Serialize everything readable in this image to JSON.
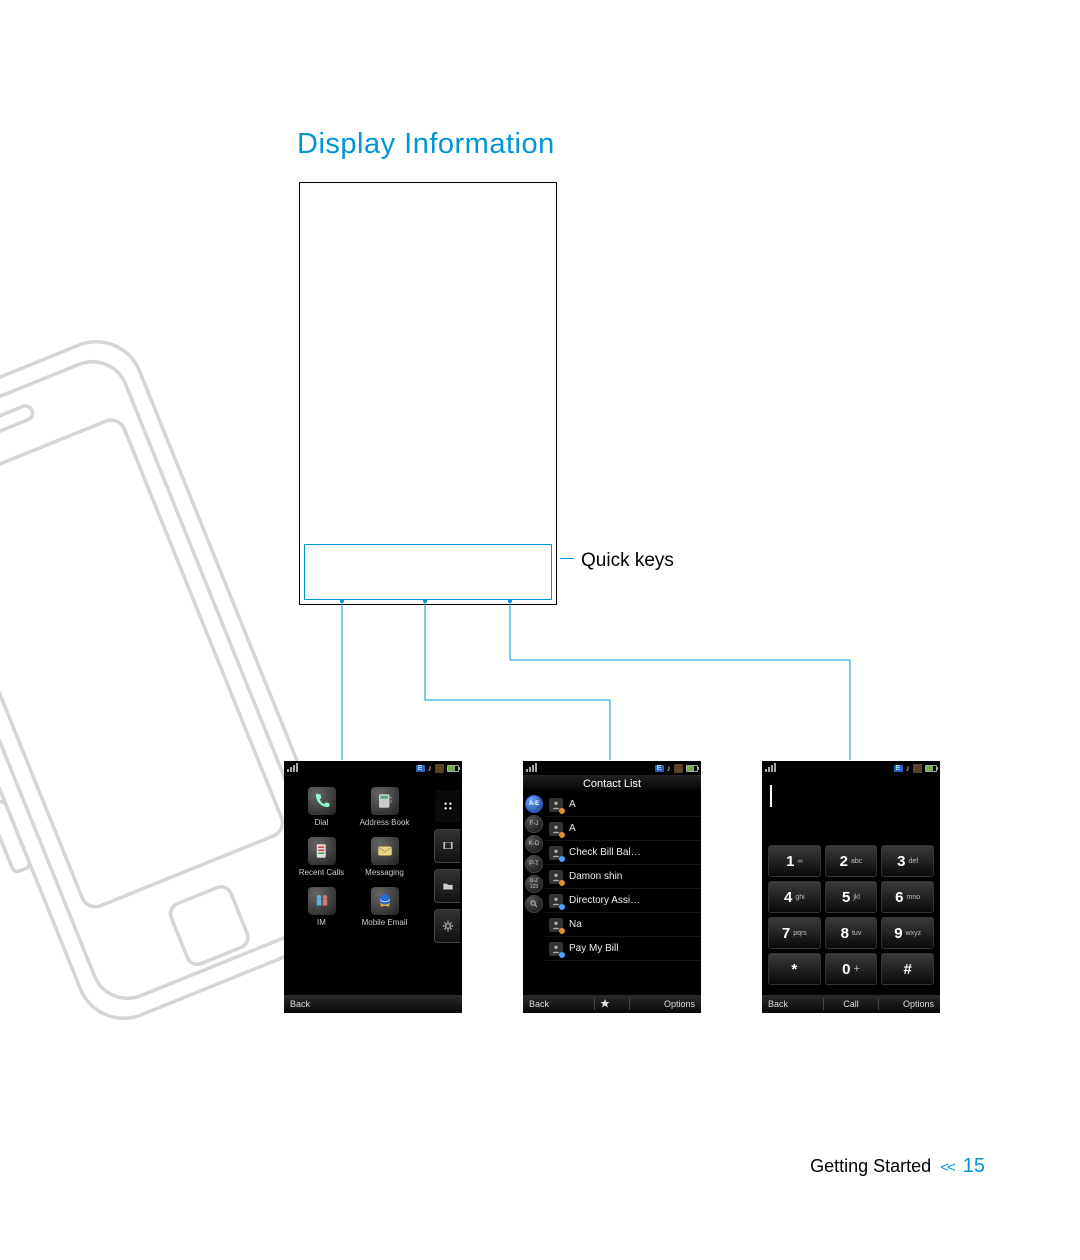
{
  "title": "Display Information",
  "callout_quick_keys": "Quick keys",
  "footer": {
    "section": "Getting Started",
    "chevrons": "<<",
    "page": "15"
  },
  "status_icons": {
    "network_badge": "E",
    "music": "♪"
  },
  "shot1": {
    "apps": [
      {
        "id": "dial",
        "label": "Dial"
      },
      {
        "id": "address-book",
        "label": "Address Book"
      },
      {
        "id": "recent-calls",
        "label": "Recent Calls"
      },
      {
        "id": "messaging",
        "label": "Messaging"
      },
      {
        "id": "im",
        "label": "IM"
      },
      {
        "id": "mobile-email",
        "label": "Mobile Email"
      }
    ],
    "side_tabs": [
      "apps",
      "media",
      "folder",
      "settings"
    ],
    "softkeys": {
      "left": "Back"
    }
  },
  "shot2": {
    "title": "Contact List",
    "alpha_tabs": [
      "A-E",
      "F-J",
      "K-O",
      "P-T",
      "U-Z 123",
      "🔍"
    ],
    "alpha_active": 0,
    "contacts": [
      {
        "name": "A",
        "dot": "#e08a2a"
      },
      {
        "name": "A",
        "dot": "#e08a2a"
      },
      {
        "name": "Check Bill Bal…",
        "dot": "#4aa3ff"
      },
      {
        "name": "Damon shin",
        "dot": "#e08a2a"
      },
      {
        "name": "Directory Assi…",
        "dot": "#4aa3ff"
      },
      {
        "name": "Na",
        "dot": "#e08a2a"
      },
      {
        "name": "Pay My Bill",
        "dot": "#4aa3ff"
      }
    ],
    "softkeys": {
      "left": "Back",
      "right": "Options"
    }
  },
  "shot3": {
    "keys": [
      {
        "digit": "1",
        "sub": "∞"
      },
      {
        "digit": "2",
        "sub": "abc"
      },
      {
        "digit": "3",
        "sub": "def"
      },
      {
        "digit": "4",
        "sub": "ghi"
      },
      {
        "digit": "5",
        "sub": "jkl"
      },
      {
        "digit": "6",
        "sub": "mno"
      },
      {
        "digit": "7",
        "sub": "pqrs"
      },
      {
        "digit": "8",
        "sub": "tuv"
      },
      {
        "digit": "9",
        "sub": "wxyz"
      },
      {
        "digit": "*",
        "sub": ""
      },
      {
        "digit": "0",
        "sub": "+"
      },
      {
        "digit": "#",
        "sub": ""
      }
    ],
    "softkeys": {
      "left": "Back",
      "center": "Call",
      "right": "Options"
    }
  }
}
